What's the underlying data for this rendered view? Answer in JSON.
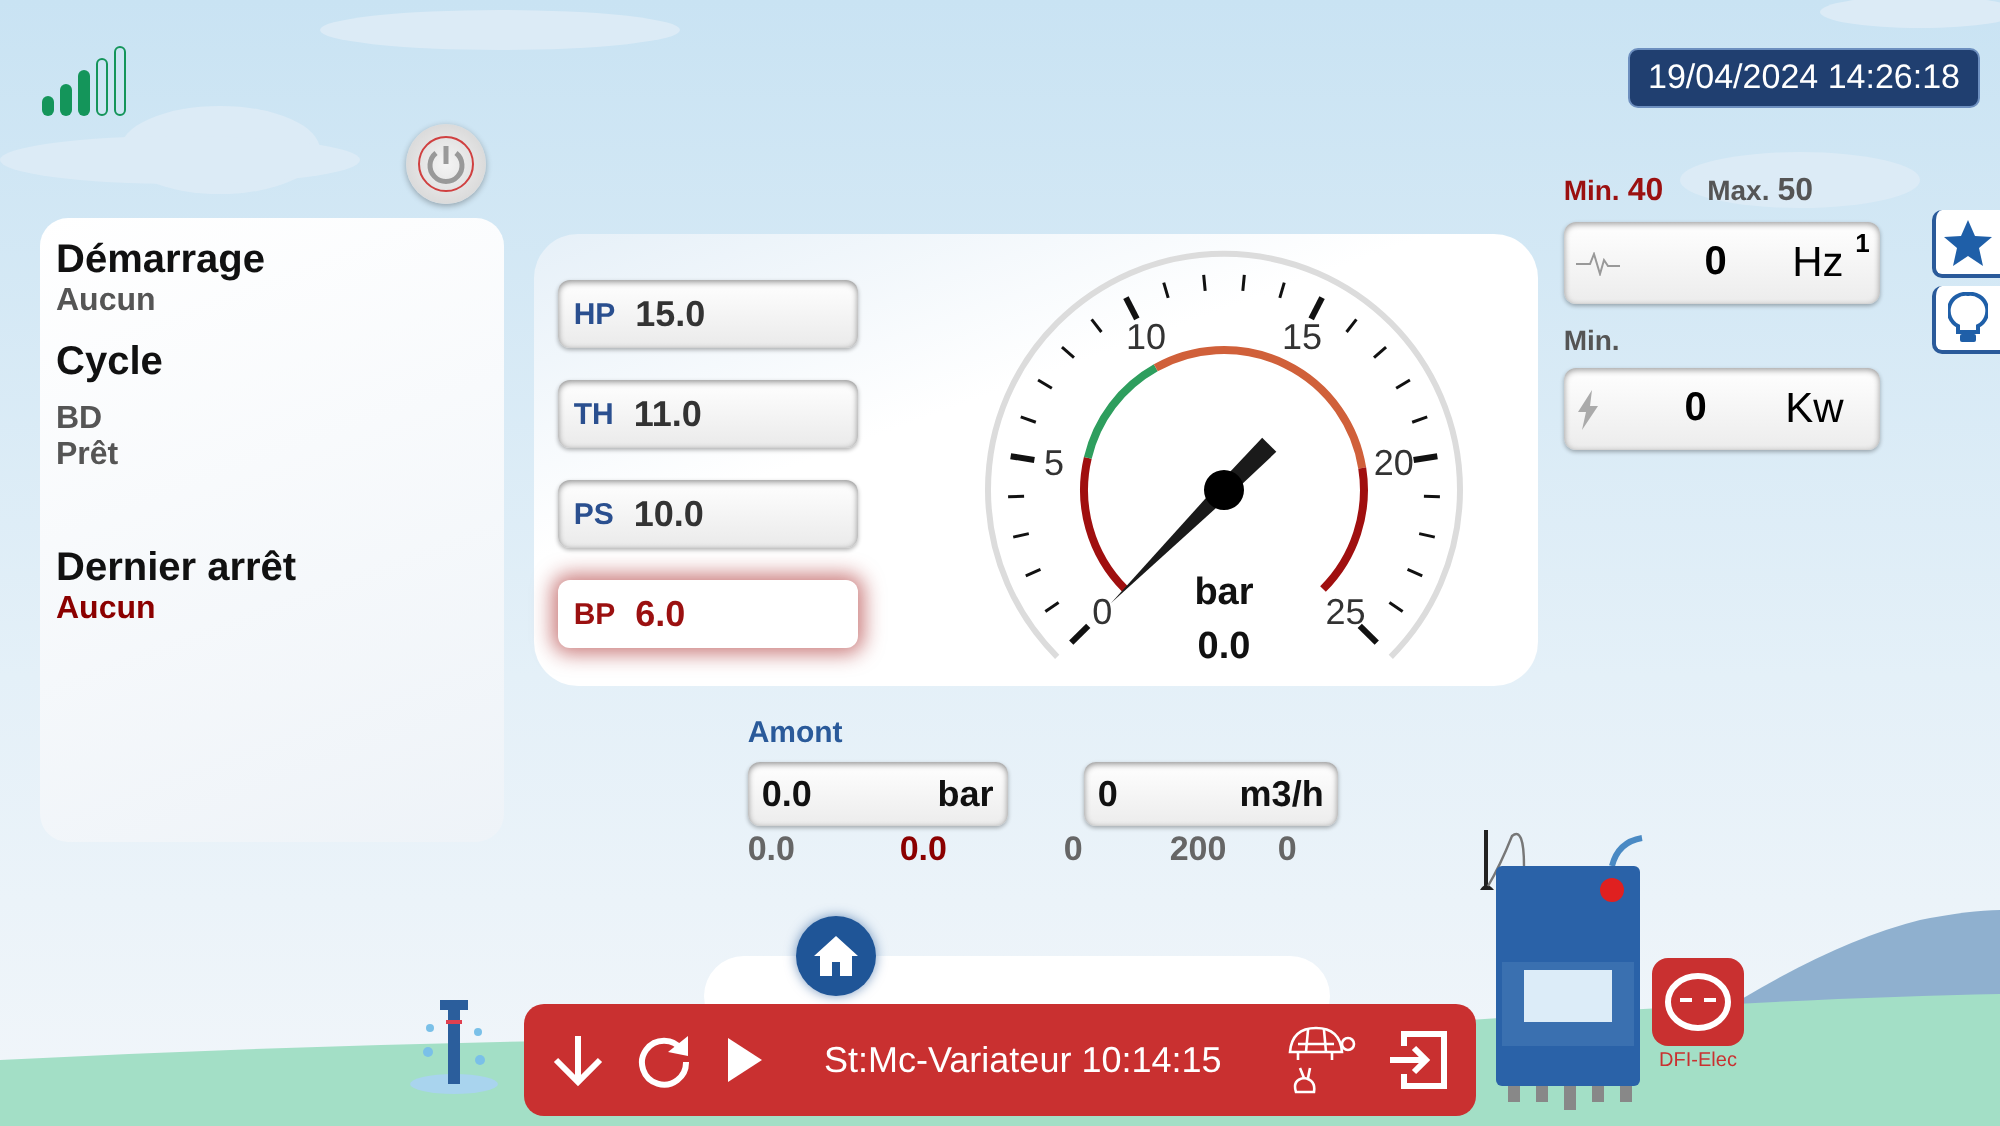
{
  "status_bar": {
    "datetime": "19/04/2024 14:26:18"
  },
  "status_card": {
    "sections": [
      {
        "title": "Démarrage",
        "lines": [
          {
            "text": "Aucun",
            "color": "#555555"
          }
        ]
      },
      {
        "title": "Cycle",
        "lines": [
          {
            "text": "BD",
            "color": "#555555"
          },
          {
            "text": "Prêt",
            "color": "#555555"
          }
        ]
      },
      {
        "title": "Dernier arrêt",
        "lines": [
          {
            "text": "Aucun",
            "color": "#8b0000"
          }
        ]
      }
    ]
  },
  "pressure_settings": [
    {
      "label": "HP",
      "value": "15.0",
      "alarm": false
    },
    {
      "label": "TH",
      "value": "11.0",
      "alarm": false
    },
    {
      "label": "PS",
      "value": "10.0",
      "alarm": false
    },
    {
      "label": "BP",
      "value": "6.0",
      "alarm": true
    }
  ],
  "gauge": {
    "scale_labels": [
      "0",
      "5",
      "10",
      "15",
      "20",
      "25"
    ],
    "unit": "bar",
    "value": "0.0"
  },
  "motor": {
    "min_label": "Min.",
    "min_value": "40",
    "max_label": "Max.",
    "max_value": "50",
    "frequency": {
      "value": "0",
      "unit": "Hz",
      "superscript": "1"
    },
    "power_min_label": "Min.",
    "power": {
      "value": "0",
      "unit": "Kw"
    }
  },
  "amont": {
    "title": "Amont",
    "fields": [
      {
        "value": "0.0",
        "unit": "bar"
      },
      {
        "value": "0",
        "unit": "m3/h"
      }
    ],
    "readings": [
      {
        "text": "0.0",
        "color": "#666666"
      },
      {
        "text": "0.0",
        "color": "#8b0000"
      },
      {
        "text": "0",
        "color": "#666666"
      },
      {
        "text": "200",
        "color": "#666666"
      },
      {
        "text": "0",
        "color": "#666666"
      }
    ]
  },
  "control_bar": {
    "status_text": "St:Mc-Variateur 10:14:15"
  },
  "logo": {
    "caption": "DFI-Elec"
  }
}
